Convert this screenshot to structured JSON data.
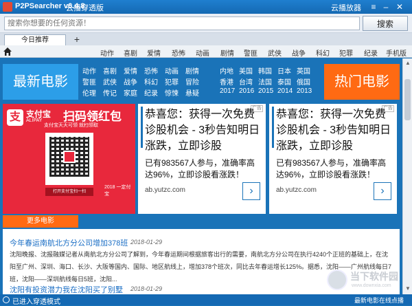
{
  "titlebar": {
    "app": "P2PSearcher v6.4.8",
    "subtitle": "云播穿透版",
    "player": "云播放器"
  },
  "search": {
    "placeholder": "搜索你想要的任何资源！",
    "button": "搜索"
  },
  "tabs": {
    "home": "今日推荐",
    "add": "+"
  },
  "nav": [
    "动作",
    "喜剧",
    "爱情",
    "恐怖",
    "动画",
    "剧情",
    "警匪",
    "武侠",
    "战争",
    "科幻",
    "犯罪",
    "纪录",
    "手机版"
  ],
  "banners": {
    "latest": "最新电影",
    "hot": "热门电影",
    "more": "更多电影"
  },
  "genres": [
    [
      "动作",
      "喜剧",
      "爱情",
      "恐怖",
      "动画",
      "剧情"
    ],
    [
      "警匪",
      "武侠",
      "战争",
      "科幻",
      "犯罪",
      "冒险"
    ],
    [
      "伦理",
      "传记",
      "家庭",
      "纪录",
      "惊悚",
      "悬疑"
    ]
  ],
  "regions": [
    [
      "内地",
      "美国",
      "韩国",
      "日本",
      "英国"
    ],
    [
      "香港",
      "台湾",
      "法国",
      "泰国",
      "俄国"
    ],
    [
      "2017",
      "2016",
      "2015",
      "2014",
      "2013"
    ]
  ],
  "alipay": {
    "logo": "支",
    "name": "支付宝",
    "sub": "ALIPAY",
    "headline": "扫码领红包",
    "note": "支付宝天天可领 就扫领取",
    "scan": "打开支付宝扫一扫",
    "year": "2018 一定付宝"
  },
  "ads": [
    {
      "tag": "广告",
      "headline": "恭喜您：获得一次免费诊股机会 - 3秒告知明日涨跌，立即诊股",
      "body": "已有983567人参与，准确率高达96%，立即诊股看涨跌！",
      "domain": "ab.yutzc.com",
      "arrow": "›"
    },
    {
      "tag": "广告",
      "headline": "恭喜您：获得一次免费诊股机会 - 3秒告知明日涨跌，立即诊股",
      "body": "已有983567人参与，准确率高达96%，立即诊股看涨跌！",
      "domain": "ab.yutzc.com",
      "arrow": "›"
    }
  ],
  "news": [
    {
      "title": "今年春运南航北方分公司增加378班",
      "date": "2018-01-29",
      "body": "沈阳晚报、沈报融媒记者从南航北方分公司了解到，今年春运期间根据旅客出行的需要，南航北方分公司在执行4240个正班的基础上，在沈阳至广州、深圳、海口、长沙、大阪等国内、国际、地区航线上，增加378个班次，同比去年春运增长125%。据悉，沈阳——广州航线每日7班，沈阳——深圳航线每日5班，沈阳..."
    },
    {
      "title": "沈阳有投资潜力我在沈阳买了别墅",
      "date": "2018-01-29"
    }
  ],
  "watermark": {
    "text": "当下软件园",
    "url": "www.downxia.com"
  },
  "status": {
    "left": "已进入穿透模式",
    "right": "最新电影在线点播"
  },
  "colors": {
    "primary": "#1a73b8",
    "orange": "#ff6a13",
    "alipay": "#e8283c",
    "light-blue": "#2c9ee8"
  }
}
